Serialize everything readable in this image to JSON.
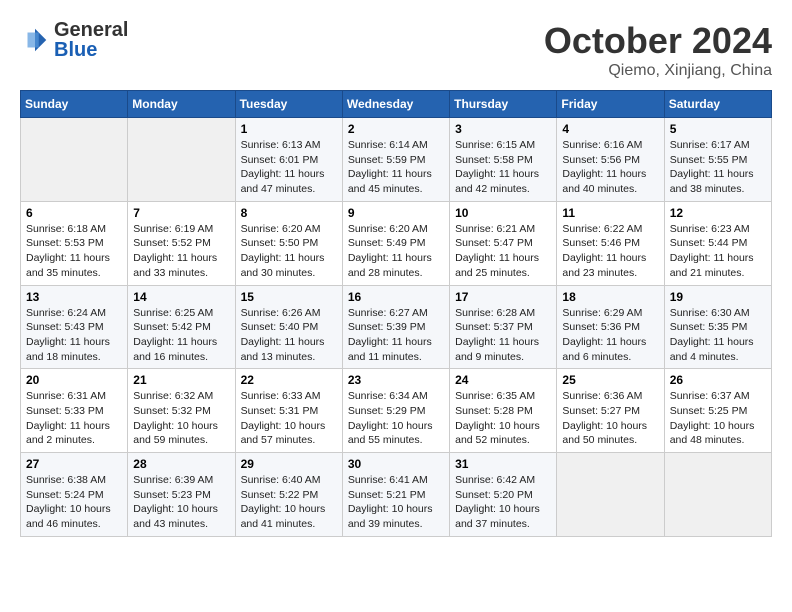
{
  "header": {
    "logo_general": "General",
    "logo_blue": "Blue",
    "title": "October 2024",
    "location": "Qiemo, Xinjiang, China"
  },
  "weekdays": [
    "Sunday",
    "Monday",
    "Tuesday",
    "Wednesday",
    "Thursday",
    "Friday",
    "Saturday"
  ],
  "weeks": [
    [
      null,
      null,
      {
        "day": "1",
        "sunrise": "6:13 AM",
        "sunset": "6:01 PM",
        "daylight": "11 hours and 47 minutes."
      },
      {
        "day": "2",
        "sunrise": "6:14 AM",
        "sunset": "5:59 PM",
        "daylight": "11 hours and 45 minutes."
      },
      {
        "day": "3",
        "sunrise": "6:15 AM",
        "sunset": "5:58 PM",
        "daylight": "11 hours and 42 minutes."
      },
      {
        "day": "4",
        "sunrise": "6:16 AM",
        "sunset": "5:56 PM",
        "daylight": "11 hours and 40 minutes."
      },
      {
        "day": "5",
        "sunrise": "6:17 AM",
        "sunset": "5:55 PM",
        "daylight": "11 hours and 38 minutes."
      }
    ],
    [
      {
        "day": "6",
        "sunrise": "6:18 AM",
        "sunset": "5:53 PM",
        "daylight": "11 hours and 35 minutes."
      },
      {
        "day": "7",
        "sunrise": "6:19 AM",
        "sunset": "5:52 PM",
        "daylight": "11 hours and 33 minutes."
      },
      {
        "day": "8",
        "sunrise": "6:20 AM",
        "sunset": "5:50 PM",
        "daylight": "11 hours and 30 minutes."
      },
      {
        "day": "9",
        "sunrise": "6:20 AM",
        "sunset": "5:49 PM",
        "daylight": "11 hours and 28 minutes."
      },
      {
        "day": "10",
        "sunrise": "6:21 AM",
        "sunset": "5:47 PM",
        "daylight": "11 hours and 25 minutes."
      },
      {
        "day": "11",
        "sunrise": "6:22 AM",
        "sunset": "5:46 PM",
        "daylight": "11 hours and 23 minutes."
      },
      {
        "day": "12",
        "sunrise": "6:23 AM",
        "sunset": "5:44 PM",
        "daylight": "11 hours and 21 minutes."
      }
    ],
    [
      {
        "day": "13",
        "sunrise": "6:24 AM",
        "sunset": "5:43 PM",
        "daylight": "11 hours and 18 minutes."
      },
      {
        "day": "14",
        "sunrise": "6:25 AM",
        "sunset": "5:42 PM",
        "daylight": "11 hours and 16 minutes."
      },
      {
        "day": "15",
        "sunrise": "6:26 AM",
        "sunset": "5:40 PM",
        "daylight": "11 hours and 13 minutes."
      },
      {
        "day": "16",
        "sunrise": "6:27 AM",
        "sunset": "5:39 PM",
        "daylight": "11 hours and 11 minutes."
      },
      {
        "day": "17",
        "sunrise": "6:28 AM",
        "sunset": "5:37 PM",
        "daylight": "11 hours and 9 minutes."
      },
      {
        "day": "18",
        "sunrise": "6:29 AM",
        "sunset": "5:36 PM",
        "daylight": "11 hours and 6 minutes."
      },
      {
        "day": "19",
        "sunrise": "6:30 AM",
        "sunset": "5:35 PM",
        "daylight": "11 hours and 4 minutes."
      }
    ],
    [
      {
        "day": "20",
        "sunrise": "6:31 AM",
        "sunset": "5:33 PM",
        "daylight": "11 hours and 2 minutes."
      },
      {
        "day": "21",
        "sunrise": "6:32 AM",
        "sunset": "5:32 PM",
        "daylight": "10 hours and 59 minutes."
      },
      {
        "day": "22",
        "sunrise": "6:33 AM",
        "sunset": "5:31 PM",
        "daylight": "10 hours and 57 minutes."
      },
      {
        "day": "23",
        "sunrise": "6:34 AM",
        "sunset": "5:29 PM",
        "daylight": "10 hours and 55 minutes."
      },
      {
        "day": "24",
        "sunrise": "6:35 AM",
        "sunset": "5:28 PM",
        "daylight": "10 hours and 52 minutes."
      },
      {
        "day": "25",
        "sunrise": "6:36 AM",
        "sunset": "5:27 PM",
        "daylight": "10 hours and 50 minutes."
      },
      {
        "day": "26",
        "sunrise": "6:37 AM",
        "sunset": "5:25 PM",
        "daylight": "10 hours and 48 minutes."
      }
    ],
    [
      {
        "day": "27",
        "sunrise": "6:38 AM",
        "sunset": "5:24 PM",
        "daylight": "10 hours and 46 minutes."
      },
      {
        "day": "28",
        "sunrise": "6:39 AM",
        "sunset": "5:23 PM",
        "daylight": "10 hours and 43 minutes."
      },
      {
        "day": "29",
        "sunrise": "6:40 AM",
        "sunset": "5:22 PM",
        "daylight": "10 hours and 41 minutes."
      },
      {
        "day": "30",
        "sunrise": "6:41 AM",
        "sunset": "5:21 PM",
        "daylight": "10 hours and 39 minutes."
      },
      {
        "day": "31",
        "sunrise": "6:42 AM",
        "sunset": "5:20 PM",
        "daylight": "10 hours and 37 minutes."
      },
      null,
      null
    ]
  ]
}
